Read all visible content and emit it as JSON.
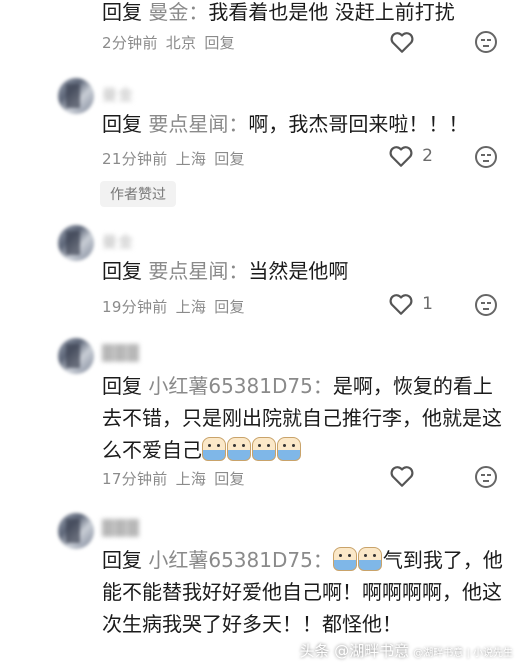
{
  "comments": [
    {
      "reply_word": "回复",
      "target": "曼金：",
      "text": "我看着也是他 没赶上前打扰",
      "time": "2分钟前",
      "location": "北京",
      "reply_link": "回复",
      "likes": ""
    },
    {
      "username": "曼金",
      "reply_word": "回复",
      "target": "要点星闻：",
      "text": "啊，我杰哥回来啦！！！",
      "time": "21分钟前",
      "location": "上海",
      "reply_link": "回复",
      "likes": "2",
      "badge": "作者赞过"
    },
    {
      "username": "曼金",
      "reply_word": "回复",
      "target": "要点星闻：",
      "text": "当然是他啊",
      "time": "19分钟前",
      "location": "上海",
      "reply_link": "回复",
      "likes": "1"
    },
    {
      "username": "███",
      "reply_word": "回复",
      "target": "小红薯65381D75：",
      "text": "是啊，恢复的看上去不错，只是刚出院就自己推行李，他就是这么不爱自己",
      "time": "17分钟前",
      "location": "上海",
      "reply_link": "回复",
      "likes": ""
    },
    {
      "username": "███",
      "reply_word": "回复",
      "target": "小红薯65381D75：",
      "text": "气到我了，他能不能替我好好爱他自己啊！啊啊啊啊，他这次生病我哭了好多天！！都怪他！",
      "time": "",
      "location": "",
      "reply_link": "",
      "likes": ""
    }
  ],
  "watermark": {
    "main": "头条 @湖畔书意",
    "sub": "@湖畔书意 | 小说先生"
  },
  "colors": {
    "meta": "#8b8b8b",
    "target": "#8a8a8a",
    "body": "#1b1b1b",
    "badge_bg": "#f2f2f2"
  },
  "icons": {
    "like": "heart-outline-icon",
    "dislike": "frown-face-icon"
  }
}
